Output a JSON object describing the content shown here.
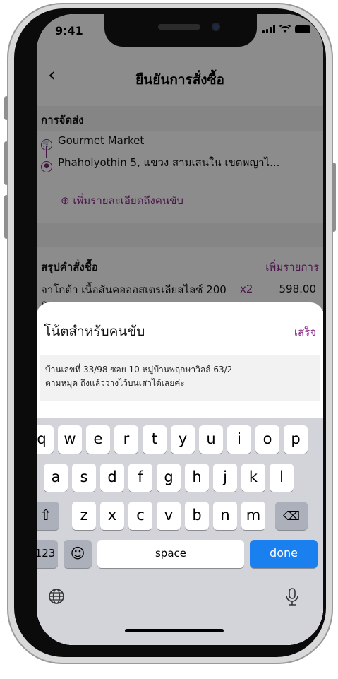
{
  "status": {
    "time": "9:41"
  },
  "header": {
    "title": "ยืนยันการสั่งซื้อ",
    "back_icon": "chevron-left-icon"
  },
  "delivery": {
    "section_label": "การจัดส่ง",
    "store_name": "Gourmet Market",
    "address": "Phaholyothin 5, แขวง สามเสนใน เขตพญาไ...",
    "add_driver_details": "เพิ่มรายละเอียดถึงคนขับ"
  },
  "order": {
    "section_label": "สรุปคำสั่งซื้อ",
    "add_items": "เพิ่มรายการ",
    "items": [
      {
        "name": "จาโกต้า เนื้อสันคอออสเตรเลียสไลซ์ 200 ก.",
        "qty": "x2",
        "price": "598.00"
      }
    ]
  },
  "note_sheet": {
    "title": "โน้ตสำหรับคนขับ",
    "done": "เสร็จ",
    "note_line1": "บ้านเลขที่ 33/98 ซอย 10 หมู่บ้านพฤกษาวิลล์ 63/2",
    "note_line2": "ตามหมุด ถึงแล้ววางไว้บนเสาได้เลยค่ะ"
  },
  "keyboard": {
    "row1": [
      "q",
      "w",
      "e",
      "r",
      "t",
      "y",
      "u",
      "i",
      "o",
      "p"
    ],
    "row2": [
      "a",
      "s",
      "d",
      "f",
      "g",
      "h",
      "j",
      "k",
      "l"
    ],
    "row3": [
      "z",
      "x",
      "c",
      "v",
      "b",
      "n",
      "m"
    ],
    "numbers_key": "123",
    "space_key": "space",
    "done_key": "done"
  },
  "colors": {
    "accent": "#8a2a8a",
    "done_blue": "#1a80f0"
  }
}
